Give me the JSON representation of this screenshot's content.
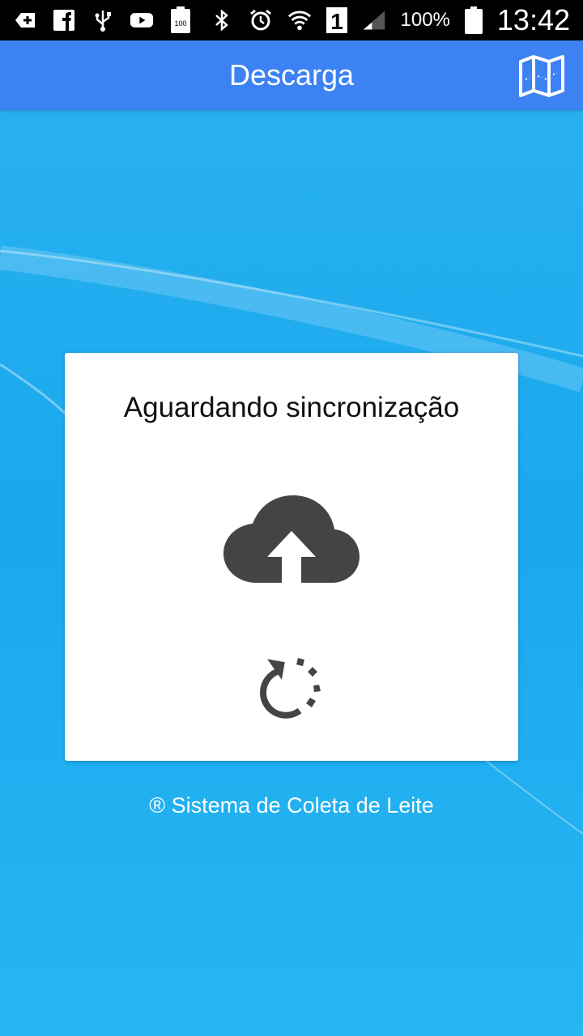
{
  "status_bar": {
    "battery_percent": "100%",
    "time": "13:42",
    "sim_slot": "1",
    "battery_saver_badge": "100",
    "icons_left": [
      "add-icon",
      "facebook-icon",
      "usb-icon",
      "youtube-icon",
      "battery-saver-icon"
    ],
    "icons_right": [
      "bluetooth-icon",
      "alarm-icon",
      "wifi-icon",
      "sim-icon",
      "signal-icon",
      "battery-icon"
    ]
  },
  "app_bar": {
    "title": "Descarga",
    "color": "#3d82f2",
    "action_icon": "map-icon"
  },
  "card": {
    "title": "Aguardando sincronização",
    "icons": [
      "cloud-upload-icon",
      "sync-refresh-icon"
    ],
    "icon_color": "#444444"
  },
  "footer": {
    "text": "® Sistema de Coleta de Leite"
  }
}
